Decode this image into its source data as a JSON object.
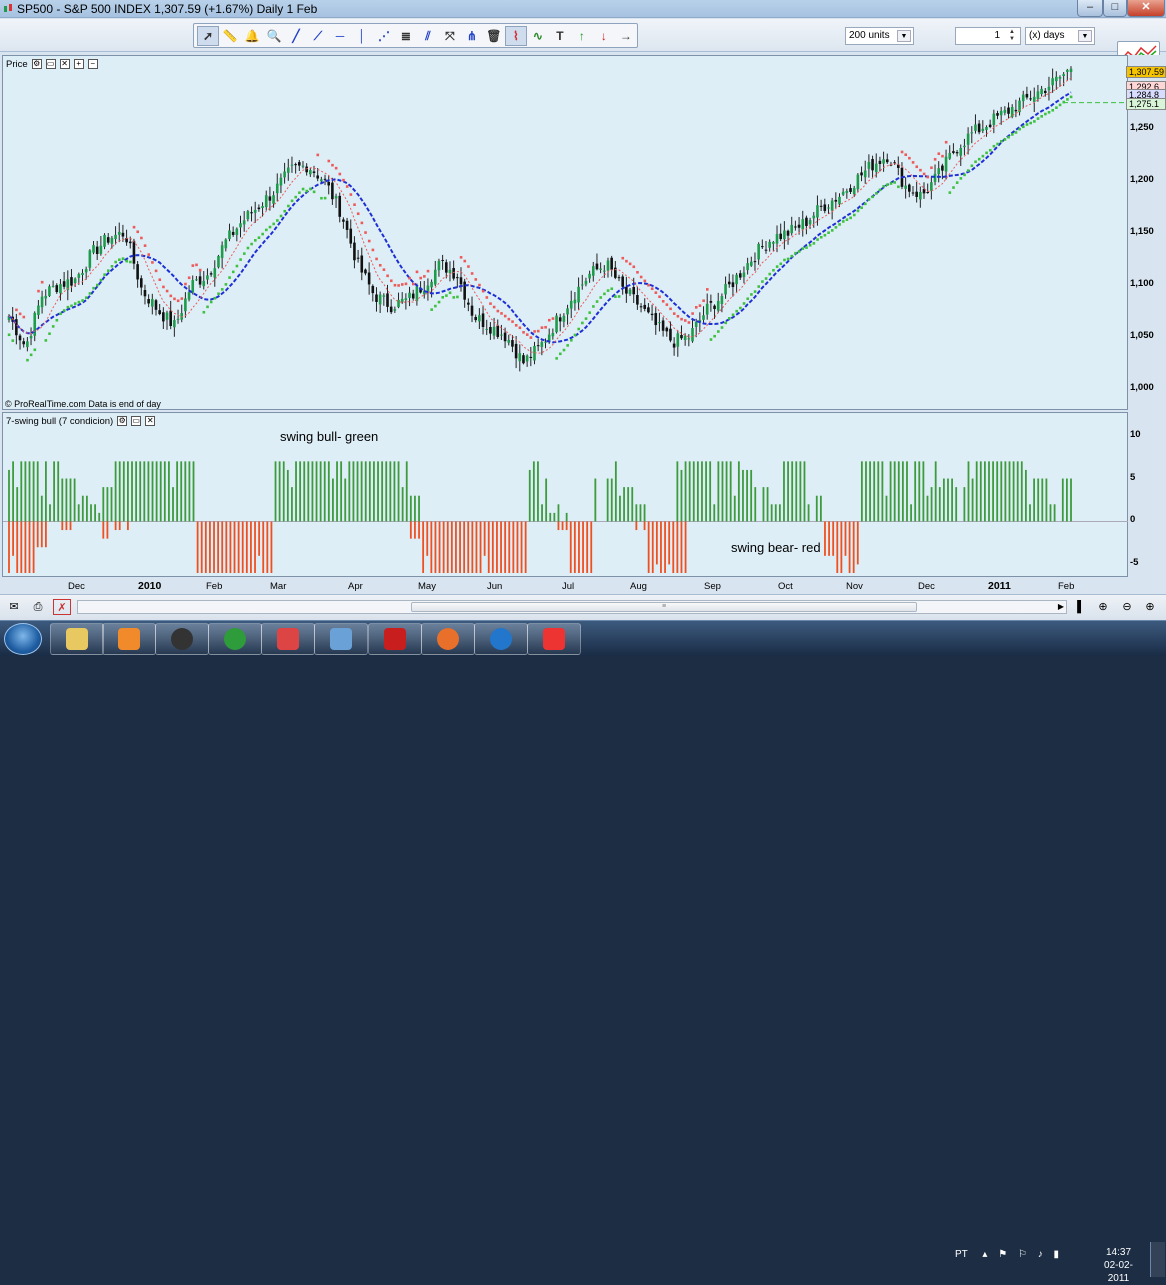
{
  "window": {
    "title": "SP500 - S&P 500 INDEX    1,307.59 (+1.67%)    Daily  1 Feb",
    "min_label": "–",
    "max_label": "□",
    "close_label": "✕"
  },
  "toolbar": {
    "tools": [
      "pointer-icon",
      "ruler-icon",
      "alert-bell-icon",
      "zoom-icon",
      "trendline-icon",
      "ray-icon",
      "horizontal-line-icon",
      "vertical-line-icon",
      "fan-icon",
      "fibonacci-icon",
      "channel-icon",
      "arrows-icon",
      "pitchfork-icon",
      "trash-icon",
      "pattern-icon",
      "wave-icon",
      "text-tool-icon",
      "up-arrow-icon",
      "down-arrow-icon",
      "right-arrow-icon"
    ],
    "units_value": "200 units",
    "quantity_value": "1",
    "period_value": "(x) days"
  },
  "price_panel": {
    "label": "Price",
    "credit": "© ProRealTime.com  Data is end of day",
    "yticks": [
      "1,250",
      "1,200",
      "1,150",
      "1,100",
      "1,050",
      "1,000"
    ],
    "tags": [
      "1,307.59",
      "1,292.6",
      "1,284.8",
      "1,275.1"
    ],
    "tag_colors": [
      "#f5c400",
      "#ffd6d6",
      "#d8dcff",
      "#d8f5d8"
    ]
  },
  "osc_panel": {
    "label": "7-swing bull (7 condicion)",
    "bull_label": "swing bull- green",
    "bear_label": "swing bear- red",
    "yticks": [
      "10",
      "5",
      "0",
      "-5"
    ]
  },
  "xaxis": {
    "labels": [
      "Dec",
      "2010",
      "Feb",
      "Mar",
      "Apr",
      "May",
      "Jun",
      "Jul",
      "Aug",
      "Sep",
      "Oct",
      "Nov",
      "Dec",
      "2011",
      "Feb"
    ]
  },
  "colors": {
    "candle_up": "#1e9b4b",
    "candle_down": "#111111",
    "sar_red": "#ee5a5a",
    "sar_green": "#3ec13e",
    "ma_blue": "#1f2fd6",
    "bull_bar": "#3d9b3d",
    "bear_bar": "#f05020"
  },
  "chart_data": {
    "type": "candlestick",
    "title": "SP500 - S&P 500 INDEX",
    "ylim": [
      990,
      1315
    ],
    "months": [
      "Dec",
      "2010",
      "Feb",
      "Mar",
      "Apr",
      "May",
      "Jun",
      "Jul",
      "Aug",
      "Sep",
      "Oct",
      "Nov",
      "Dec",
      "2011",
      "Feb"
    ],
    "close_path": [
      1070,
      1040,
      1090,
      1100,
      1105,
      1130,
      1145,
      1150,
      1095,
      1075,
      1060,
      1100,
      1110,
      1140,
      1160,
      1175,
      1190,
      1210,
      1215,
      1200,
      1170,
      1120,
      1090,
      1080,
      1085,
      1100,
      1120,
      1110,
      1070,
      1060,
      1050,
      1025,
      1040,
      1065,
      1090,
      1110,
      1120,
      1095,
      1080,
      1060,
      1045,
      1050,
      1075,
      1090,
      1110,
      1130,
      1145,
      1150,
      1160,
      1175,
      1185,
      1200,
      1215,
      1225,
      1195,
      1185,
      1205,
      1230,
      1245,
      1255,
      1265,
      1275,
      1285,
      1295,
      1307.59
    ],
    "last_close": 1307.59,
    "change_pct": 1.67,
    "oscillator": {
      "name": "7-swing bull (7 condicion)",
      "ylim": [
        -6,
        11
      ],
      "bull_profile": [
        7,
        7,
        7,
        7,
        5,
        3,
        2,
        4,
        7,
        7,
        7,
        7,
        7,
        7,
        0,
        0,
        0,
        0,
        0,
        0,
        7,
        7,
        7,
        7,
        7,
        7,
        7,
        7,
        7,
        7,
        3,
        0,
        0,
        0,
        0,
        0,
        0,
        0,
        0,
        7,
        5,
        2,
        0,
        0,
        5,
        7,
        4,
        2,
        0,
        0,
        7,
        7,
        7,
        7,
        7,
        6,
        4,
        2,
        7,
        7,
        3,
        0,
        0,
        0,
        7,
        7,
        7,
        7,
        7,
        7,
        5,
        4,
        7,
        7,
        7,
        7,
        7,
        5,
        2,
        5
      ],
      "bear_profile": [
        -6,
        -6,
        -3,
        0,
        -1,
        0,
        0,
        -2,
        -1,
        0,
        0,
        0,
        0,
        0,
        -6,
        -6,
        -6,
        -6,
        -6,
        -6,
        0,
        0,
        0,
        0,
        0,
        0,
        0,
        0,
        0,
        0,
        -2,
        -6,
        -6,
        -6,
        -6,
        -6,
        -6,
        -6,
        -6,
        0,
        0,
        -1,
        -6,
        -6,
        0,
        0,
        0,
        -1,
        -6,
        -6,
        -6,
        0,
        0,
        0,
        0,
        0,
        0,
        0,
        0,
        0,
        0,
        -4,
        -6,
        -6,
        0,
        0,
        0,
        0,
        0,
        0,
        0,
        0,
        0,
        0,
        0,
        0,
        0,
        0,
        0,
        0
      ]
    }
  }
}
